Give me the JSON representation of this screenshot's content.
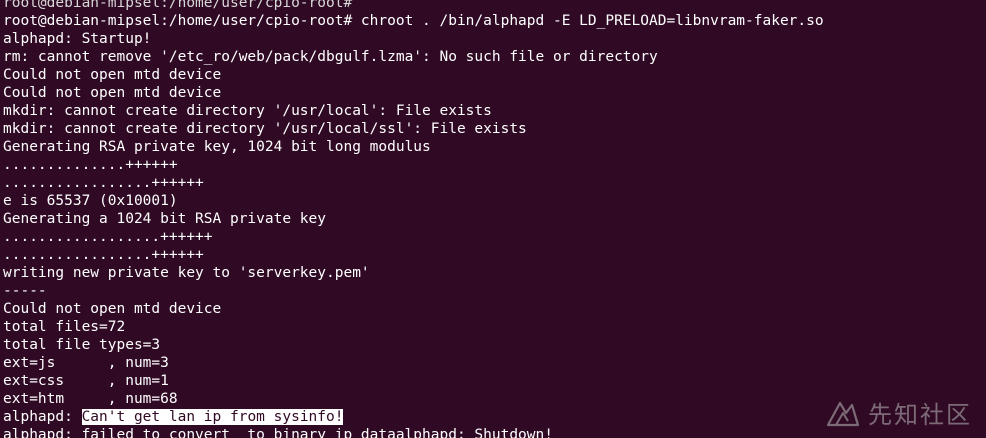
{
  "terminal": {
    "lines": [
      "root@debian-mipsel:/home/user/cpio-root# ",
      "root@debian-mipsel:/home/user/cpio-root# chroot . /bin/alphapd -E LD_PRELOAD=libnvram-faker.so",
      "alphapd: Startup!",
      "rm: cannot remove '/etc_ro/web/pack/dbgulf.lzma': No such file or directory",
      "Could not open mtd device",
      "Could not open mtd device",
      "mkdir: cannot create directory '/usr/local': File exists",
      "mkdir: cannot create directory '/usr/local/ssl': File exists",
      "Generating RSA private key, 1024 bit long modulus",
      "..............++++++",
      ".................++++++",
      "e is 65537 (0x10001)",
      "Generating a 1024 bit RSA private key",
      "..................++++++",
      ".................++++++",
      "writing new private key to 'serverkey.pem'",
      "-----",
      "Could not open mtd device",
      "total files=72",
      "total file types=3",
      "ext=js      , num=3",
      "ext=css     , num=1",
      "ext=htm     , num=68"
    ],
    "highlight_line": {
      "prefix": "alphapd: ",
      "selected": "Can't get lan ip from sysinfo!"
    },
    "last_line": {
      "before_cursor": "alphapd: failed to convert  to binary ip ",
      "cursor_text": "data",
      "after_cursor": "alphapd: Shutdown!"
    }
  },
  "watermark": {
    "text": "先知社区",
    "icon": "xianzhi-logo-icon"
  },
  "colors": {
    "background": "#300a24",
    "foreground": "#ffffff"
  }
}
